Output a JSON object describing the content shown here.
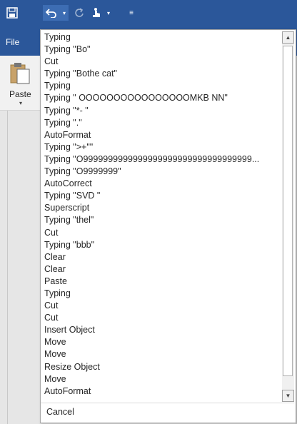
{
  "toolbar": {
    "save_icon": "save-icon",
    "undo_icon": "undo-icon",
    "redo_icon": "redo-icon",
    "touch_mode_icon": "touch-mode-icon",
    "customize_icon": "customize-qat-icon"
  },
  "ribbon": {
    "file_tab": "File",
    "paste_label": "Paste"
  },
  "undo_list": {
    "items": [
      "Typing",
      "Typing \"Bo\"",
      "Cut",
      "Typing \"Bothe cat\"",
      "Typing",
      "Typing \" OOOOOOOOOOOOOOOOMKB NN\"",
      "Typing \"*- \"",
      "Typing \".\"",
      "AutoFormat",
      "Typing \">+\"\"",
      "Typing \"O9999999999999999999999999999999999...",
      "Typing \"O9999999\"",
      "AutoCorrect",
      "Typing \"SVD \"",
      "Superscript",
      "Typing \"thel\"",
      "Cut",
      "Typing \"bbb\"",
      "Clear",
      "Clear",
      "Paste",
      "Typing",
      "Cut",
      "Cut",
      "Insert Object",
      "Move",
      "Move",
      "Resize Object",
      "Move",
      "AutoFormat"
    ],
    "cancel_label": "Cancel"
  },
  "colors": {
    "title_bar": "#2b579a",
    "popup_bg": "#ffffff"
  }
}
